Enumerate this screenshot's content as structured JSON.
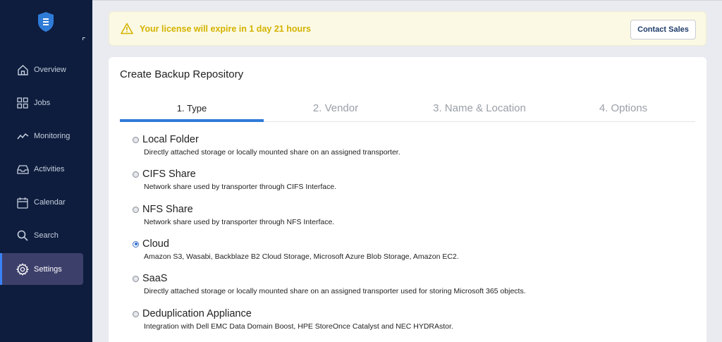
{
  "sidebar": {
    "items": [
      {
        "label": "Overview",
        "icon": "home-icon"
      },
      {
        "label": "Jobs",
        "icon": "grid-icon"
      },
      {
        "label": "Monitoring",
        "icon": "pulse-icon"
      },
      {
        "label": "Activities",
        "icon": "inbox-icon"
      },
      {
        "label": "Calendar",
        "icon": "calendar-icon"
      },
      {
        "label": "Search",
        "icon": "search-icon"
      },
      {
        "label": "Settings",
        "icon": "gear-icon",
        "active": true
      }
    ]
  },
  "banner": {
    "message": "Your license will expire in 1 day 21 hours",
    "button": "Contact Sales"
  },
  "wizard": {
    "title": "Create Backup Repository",
    "tabs": [
      {
        "label": "1. Type",
        "active": true
      },
      {
        "label": "2. Vendor"
      },
      {
        "label": "3. Name & Location"
      },
      {
        "label": "4. Options"
      }
    ],
    "options": [
      {
        "label": "Local Folder",
        "desc": "Directly attached storage or locally mounted share on an assigned transporter.",
        "checked": false
      },
      {
        "label": "CIFS Share",
        "desc": "Network share used by transporter through CIFS Interface.",
        "checked": false
      },
      {
        "label": "NFS Share",
        "desc": "Network share used by transporter through NFS Interface.",
        "checked": false
      },
      {
        "label": "Cloud",
        "desc": "Amazon S3, Wasabi, Backblaze B2 Cloud Storage, Microsoft Azure Blob Storage, Amazon EC2.",
        "checked": true
      },
      {
        "label": "SaaS",
        "desc": "Directly attached storage or locally mounted share on an assigned transporter used for storing Microsoft 365 objects.",
        "checked": false
      },
      {
        "label": "Deduplication Appliance",
        "desc": "Integration with Dell EMC Data Domain Boost, HPE StoreOnce Catalyst and NEC HYDRAstor.",
        "checked": false
      }
    ]
  },
  "colors": {
    "sidebar_bg": "#0e1d3d",
    "accent": "#2f7bd8",
    "warning_text": "#d4b300",
    "banner_bg": "#fbf9e4"
  }
}
